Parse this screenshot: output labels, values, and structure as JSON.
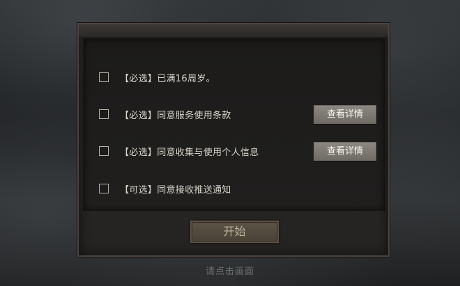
{
  "consent_dialog": {
    "options": [
      {
        "label": "【必选】已满16周岁。",
        "checked": false,
        "has_detail": false
      },
      {
        "label": "【必选】同意服务使用条款",
        "checked": false,
        "has_detail": true
      },
      {
        "label": "【必选】同意收集与使用个人信息",
        "checked": false,
        "has_detail": true
      },
      {
        "label": "【可选】同意接收推送通知",
        "checked": false,
        "has_detail": false
      }
    ],
    "detail_button_label": "查看详情",
    "start_button_label": "开始"
  },
  "tap_hint": "请点击画面",
  "colors": {
    "panel_border": "#4a4540",
    "detail_button_bg": "#807c76",
    "start_button_bg": "#534a3e",
    "label_text": "#d8d4cc"
  }
}
